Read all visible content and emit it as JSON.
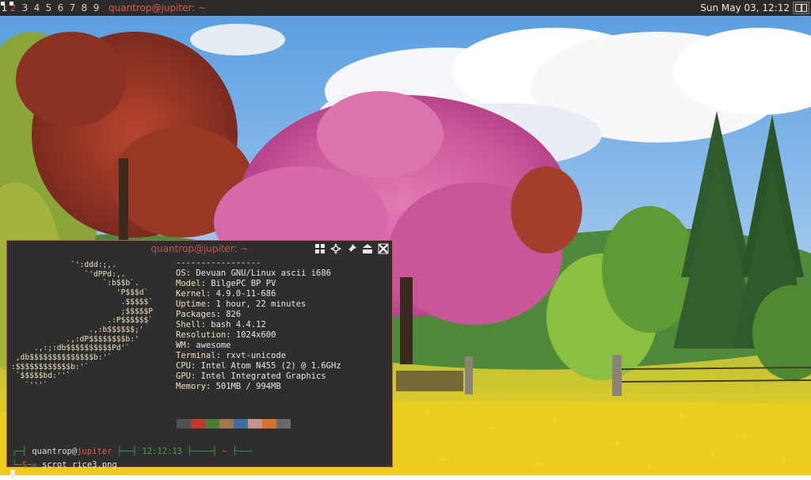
{
  "topbar": {
    "tags": [
      "1",
      "2",
      "3",
      "4",
      "5",
      "6",
      "7",
      "8",
      "9"
    ],
    "active_tag": "1",
    "urgent_tag": "2",
    "task_title": "quantrop@jupiter: ~",
    "clock": "Sun May 03, 12:12",
    "layout_icon": "tile-layout-icon",
    "colors": {
      "bg": "#2b2b2b",
      "urgent": "#e04a4a",
      "title": "#e05b4b"
    }
  },
  "terminal": {
    "title": "quantrop@jupiter: ~",
    "controls": [
      "floating-icon",
      "move-icon",
      "sticky-icon",
      "maximize-icon",
      "close-icon"
    ],
    "ascii_art": "             `':ddd:;,.\n                `'dPPd:,.\n                    `:b$$b`.\n                       'P$$$d`\n                        .$$$$$`\n                        ;$$$$$P\n                     .:P$$$$$$`\n                 .,:b$$$$$$;'\n            .,:dP$$$$$$$$b:'\n     .,:;:db$$$$$$$$$$Pd'`\n ,db$$$$$$$$$$$$$$b:'`\n:$$$$$$$$$$$$b:'`\n `$$$$$bd:''`\n   `'''`",
    "separator": "-----------------",
    "info": [
      {
        "key": "OS",
        "value": "Devuan GNU/Linux ascii i686"
      },
      {
        "key": "Model",
        "value": "BilgePC BP PV"
      },
      {
        "key": "Kernel",
        "value": "4.9.0-11-686"
      },
      {
        "key": "Uptime",
        "value": "1 hour, 22 minutes"
      },
      {
        "key": "Packages",
        "value": "826"
      },
      {
        "key": "Shell",
        "value": "bash 4.4.12"
      },
      {
        "key": "Resolution",
        "value": "1024x600"
      },
      {
        "key": "WM",
        "value": "awesome"
      },
      {
        "key": "Terminal",
        "value": "rxvt-unicode"
      },
      {
        "key": "CPU",
        "value": "Intel Atom N455 (2) @ 1.6GHz"
      },
      {
        "key": "GPU",
        "value": "Intel Integrated Graphics"
      },
      {
        "key": "Memory",
        "value": "501MB / 994MB"
      }
    ],
    "palette": [
      "#525252",
      "#c0392b",
      "#4f7a3a",
      "#a0784e",
      "#3f6ea3",
      "#c49585",
      "#d8732f",
      "#6a6a6a"
    ],
    "prompt": {
      "user": "quantrop",
      "host": "jupiter",
      "time": "12:12:13",
      "dir": "~"
    },
    "command": "scrot rice3.png"
  }
}
